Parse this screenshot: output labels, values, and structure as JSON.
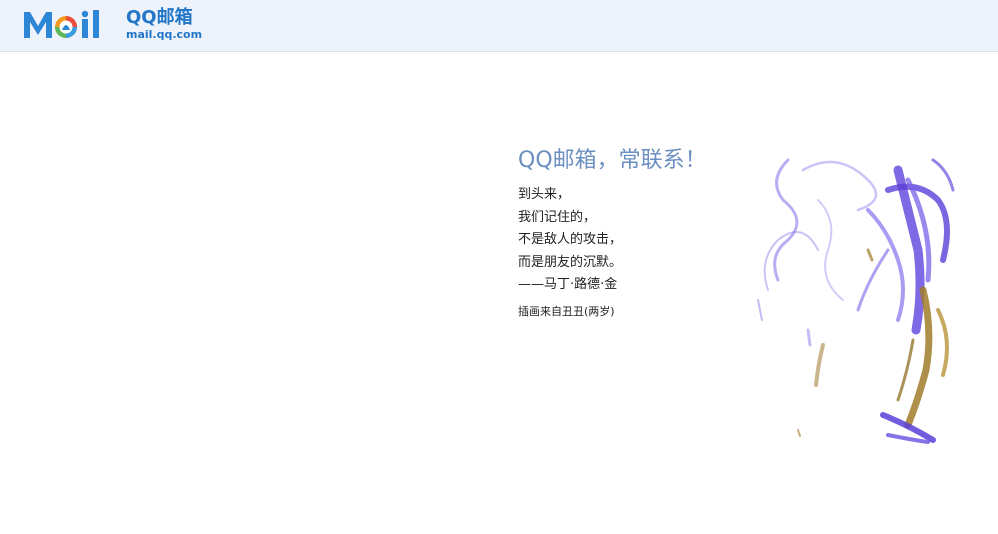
{
  "header": {
    "logo_word": "Mail",
    "brand": "QQ邮箱",
    "domain": "mail.qq.com"
  },
  "message": {
    "headline": "QQ邮箱，常联系！",
    "poem": [
      "到头来，",
      "我们记住的，",
      "不是敌人的攻击，",
      "而是朋友的沉默。",
      "——马丁·路德·金"
    ],
    "credit": "插画来自丑丑(两岁)"
  },
  "colors": {
    "header_bg": "#eef3fb",
    "brand_blue": "#2176c7",
    "headline": "#6b8fc0",
    "paint_purple": "#6a4fe0",
    "paint_gold": "#a07d2a"
  }
}
